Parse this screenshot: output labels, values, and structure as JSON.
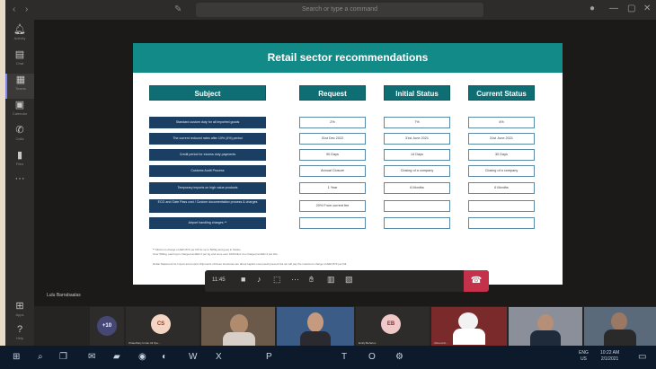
{
  "window": {
    "search_placeholder": "Search or type a command"
  },
  "rail": {
    "items": [
      {
        "label": "Activity",
        "icon": "bell-icon"
      },
      {
        "label": "Chat",
        "icon": "chat-icon"
      },
      {
        "label": "Teams",
        "icon": "teams-icon"
      },
      {
        "label": "Calendar",
        "icon": "calendar-icon"
      },
      {
        "label": "Calls",
        "icon": "phone-icon"
      },
      {
        "label": "Files",
        "icon": "file-icon"
      }
    ],
    "bottom": [
      {
        "label": "Apps",
        "icon": "apps-icon"
      },
      {
        "label": "Help",
        "icon": "help-icon"
      }
    ]
  },
  "slide": {
    "title": "Retail sector recommendations",
    "columns": [
      "Subject",
      "Request",
      "Initial Status",
      "Current Status"
    ],
    "rows": [
      {
        "subject": "Standard custom duty for all imported goods",
        "request": "2%",
        "initial": "7%",
        "current": "4%"
      },
      {
        "subject": "The current reduced rates after 10% (4%) period",
        "request": "31st Dec 2022",
        "initial": "31st June 2021",
        "current": "31st June 2021"
      },
      {
        "subject": "Credit period for excess duty payments",
        "request": "90 Days",
        "initial": "14 Days",
        "current": "30 Days"
      },
      {
        "subject": "Customs Audit Process",
        "request": "Annual Closure",
        "initial": "Closing of a company",
        "current": "Closing of a company"
      },
      {
        "subject": "Temporary imports on high value products",
        "request": "1 Year",
        "initial": "6 Months",
        "current": "6 Months"
      },
      {
        "subject": "ECG and Gate Pass cost / Custom documentation process & charges",
        "request": "20% From current fee",
        "initial": "",
        "current": ""
      },
      {
        "subject": "Airport handling charges **",
        "request": "",
        "initial": "",
        "current": ""
      }
    ],
    "footnotes": [
      "** Minimum charge of AED 873 per bill for up to 500kg and goes in blocks.",
      "Over 500kg, each kg is charged at AED 2 per kg and once over 1000 kilos it is charged at AED 3 per kilo.",
      "Dubai Statement for import and export shipments of these structures are about logistic cost would prevent but we will pay the maximum charge of AED 873 per bill."
    ]
  },
  "presenter": "Lulu Barrabaalas",
  "call": {
    "time": "11:45",
    "controls": [
      "camera-icon",
      "mic-icon",
      "share-icon",
      "more-icon",
      "raise-hand-icon",
      "reactions-icon",
      "rooms-icon"
    ],
    "leave_icon": "hang-up-icon"
  },
  "participants": [
    {
      "initials": "+10",
      "name": "",
      "color": "#464775"
    },
    {
      "initials": "CS",
      "name": "Chaudhary Imran Ali Ilya...",
      "color": "#f4d5c4"
    },
    {
      "initials": "",
      "name": "",
      "color": "#6b5a4a"
    },
    {
      "initials": "",
      "name": "",
      "color": "#3b5c86"
    },
    {
      "initials": "EB",
      "name": "Emily Beharov",
      "color": "#f0c8c8"
    },
    {
      "initials": "",
      "name": "Ahmed Al...",
      "color": "#7a2a2a"
    },
    {
      "initials": "",
      "name": "",
      "color": "#8a8f9a"
    },
    {
      "initials": "",
      "name": "",
      "color": "#5a6a7a"
    }
  ],
  "taskbar": {
    "apps": [
      "start-icon",
      "search-icon",
      "task-view-icon",
      "mail-icon",
      "folder-icon",
      "chrome-icon",
      "edge-icon",
      "word-icon",
      "excel-icon",
      "powerpoint-icon",
      "teams-icon",
      "outlook-icon",
      "settings-icon"
    ],
    "tray_lang": "ENG",
    "tray_region": "US",
    "clock_time": "10:22 AM",
    "clock_date": "2/1/2021"
  }
}
